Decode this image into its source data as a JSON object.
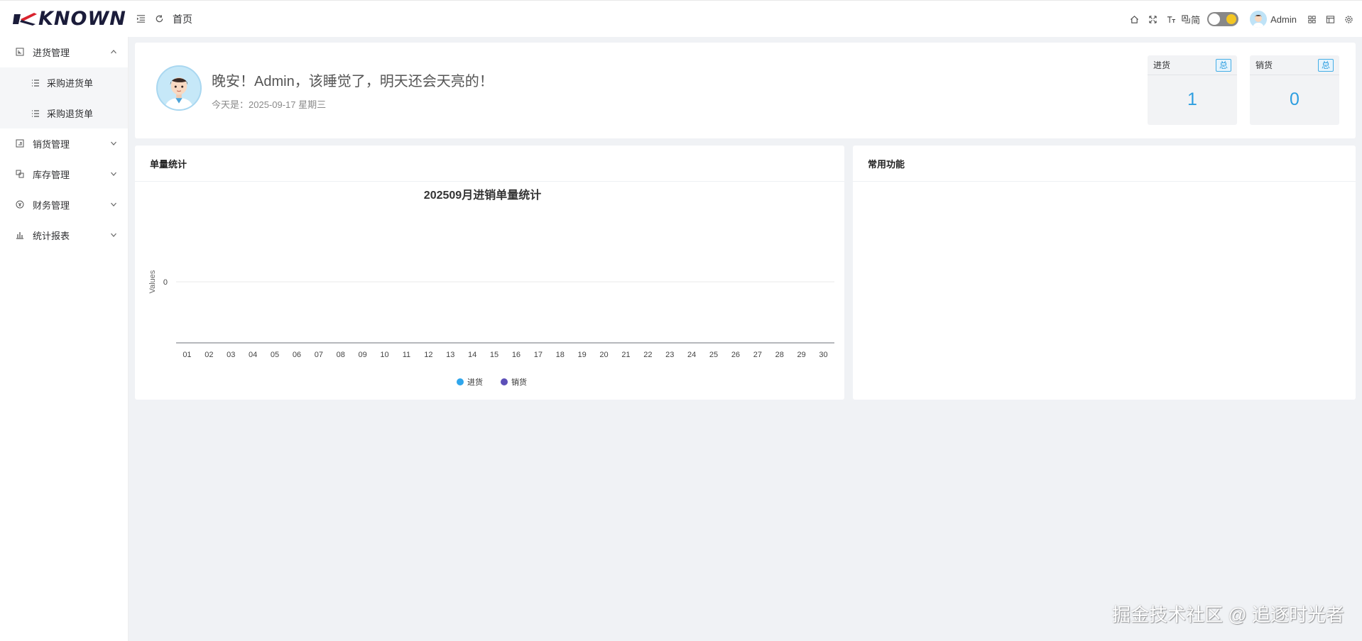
{
  "app": {
    "logo_text": "KNOWN",
    "brand_color": "#d9232e"
  },
  "header": {
    "breadcrumb_home": "首页",
    "lang_label": "简",
    "user_name": "Admin"
  },
  "sidebar": {
    "items": [
      {
        "label": "进货管理",
        "expanded": true,
        "children": [
          {
            "label": "采购进货单"
          },
          {
            "label": "采购退货单"
          }
        ]
      },
      {
        "label": "销货管理",
        "expanded": false
      },
      {
        "label": "库存管理",
        "expanded": false
      },
      {
        "label": "财务管理",
        "expanded": false
      },
      {
        "label": "统计报表",
        "expanded": false
      }
    ]
  },
  "welcome": {
    "greeting": "晚安！Admin，该睡觉了，明天还会天亮的！",
    "today": "今天是：2025-09-17 星期三",
    "stats": [
      {
        "label": "进货",
        "tag": "总",
        "value": "1"
      },
      {
        "label": "销货",
        "tag": "总",
        "value": "0"
      }
    ]
  },
  "panels": {
    "chart_title": "单量统计",
    "functions_title": "常用功能"
  },
  "chart_data": {
    "type": "bar",
    "title": "202509月进销单量统计",
    "ylabel": "Values",
    "xlabel": "",
    "categories": [
      "01",
      "02",
      "03",
      "04",
      "05",
      "06",
      "07",
      "08",
      "09",
      "10",
      "11",
      "12",
      "13",
      "14",
      "15",
      "16",
      "17",
      "18",
      "19",
      "20",
      "21",
      "22",
      "23",
      "24",
      "25",
      "26",
      "27",
      "28",
      "29",
      "30"
    ],
    "series": [
      {
        "name": "进货",
        "color": "#2fa6ec",
        "values": [
          0,
          0,
          0,
          0,
          0,
          0,
          0,
          0,
          0,
          0,
          0,
          0,
          0,
          0,
          0,
          0,
          0,
          0,
          0,
          0,
          0,
          0,
          0,
          0,
          0,
          0,
          0,
          0,
          0,
          0
        ]
      },
      {
        "name": "销货",
        "color": "#5c4fb8",
        "values": [
          0,
          0,
          0,
          0,
          0,
          0,
          0,
          0,
          0,
          0,
          0,
          0,
          0,
          0,
          0,
          0,
          0,
          0,
          0,
          0,
          0,
          0,
          0,
          0,
          0,
          0,
          0,
          0,
          0,
          0
        ]
      }
    ],
    "yticks": [
      "0"
    ],
    "legend_position": "bottom-center"
  },
  "watermark": "掘金技术社区 @ 追逐时光者"
}
